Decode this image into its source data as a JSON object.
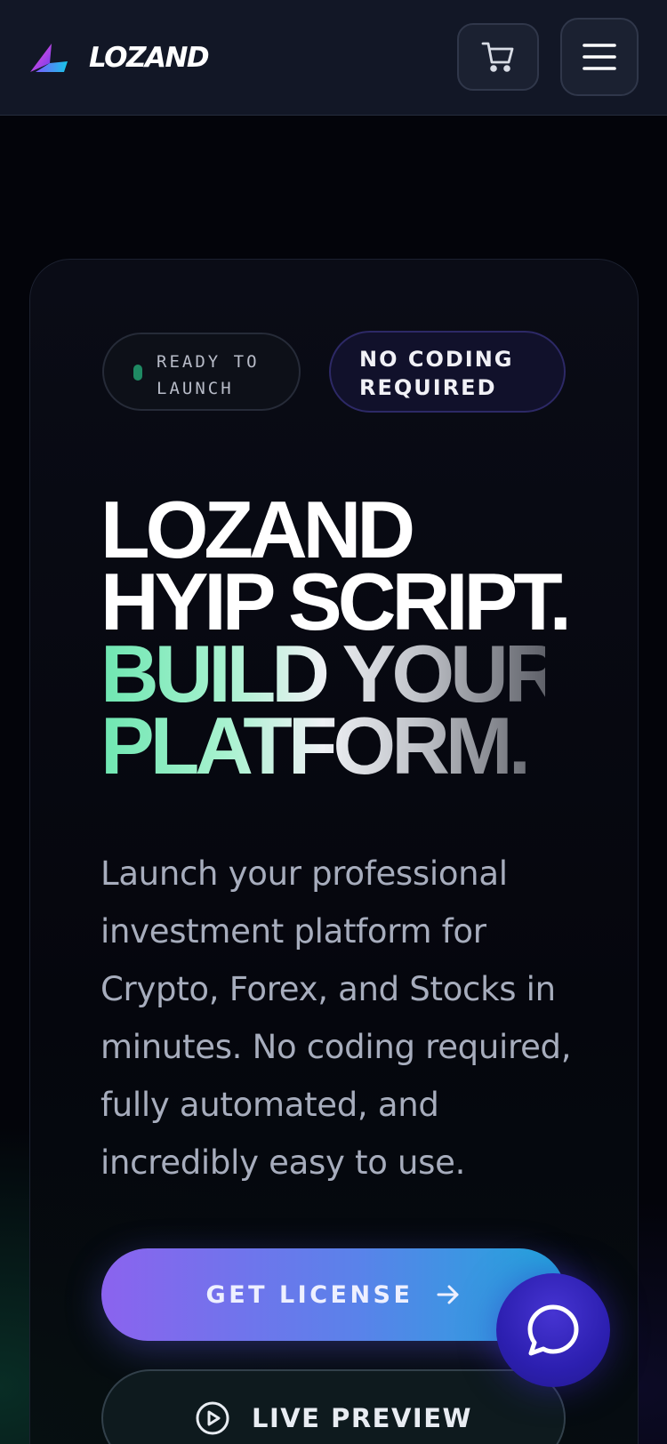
{
  "header": {
    "brand": "LOZAND",
    "cart_icon": "cart-icon",
    "menu_icon": "hamburger-menu-icon"
  },
  "hero": {
    "badge_ready": "READY TO\nLAUNCH",
    "badge_nocode": "NO CODING\nREQUIRED",
    "headline": {
      "line1": "LOZAND",
      "line2": "HYIP SCRIPT.",
      "line3": "BUILD YOUR",
      "line4": "PLATFORM."
    },
    "description": "Launch your professional investment platform for Crypto, Forex, and Stocks in minutes. No coding required, fully automated, and incredibly easy to use.",
    "cta_primary": "GET LICENSE",
    "cta_secondary": "LIVE PREVIEW"
  },
  "chat": {
    "icon": "chat-bubble-icon"
  },
  "colors": {
    "background": "#03040a",
    "header": "#121726",
    "accent_green": "#6ee6b1",
    "accent_purple": "#8b63ee",
    "accent_blue": "#20a7db",
    "status_dot": "#1f8a63"
  }
}
